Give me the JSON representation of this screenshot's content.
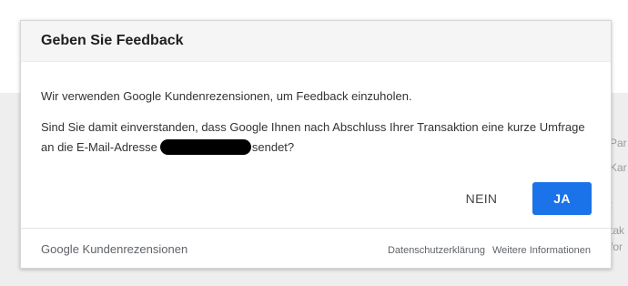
{
  "background": {
    "side_fragments": [
      "Par",
      "Kar",
      ":",
      "tak",
      "for"
    ]
  },
  "dialog": {
    "title": "Geben Sie Feedback",
    "paragraph1": "Wir verwenden Google Kundenrezensionen, um Feedback einzuholen.",
    "paragraph2_before": "Sind Sie damit einverstanden, dass Google Ihnen nach Abschluss Ihrer Transaktion eine kurze Umfrage an die E-Mail-Adresse",
    "paragraph2_after": "sendet?",
    "no_label": "NEIN",
    "yes_label": "JA",
    "footer_brand": "Google Kundenrezensionen",
    "privacy_link": "Datenschutzerklärung",
    "more_info_link": "Weitere Informationen",
    "accent_color": "#1a73e8"
  }
}
